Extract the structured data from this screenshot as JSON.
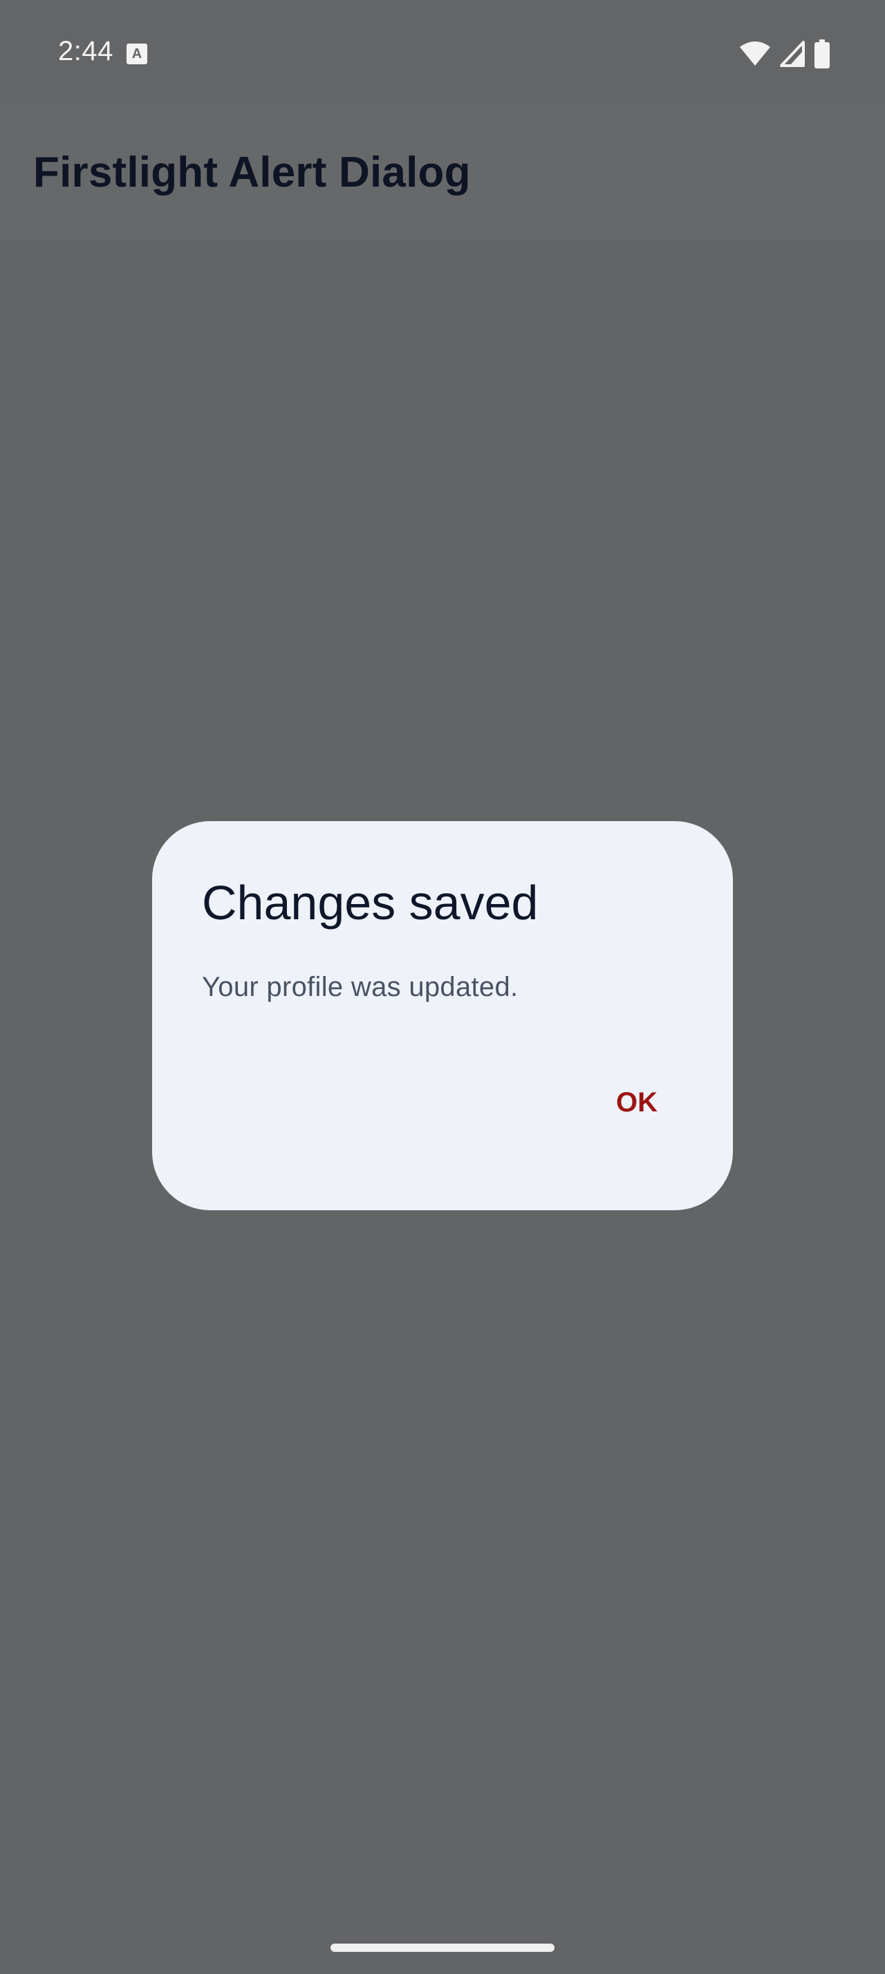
{
  "status_bar": {
    "time": "2:44",
    "notification_icon_letter": "A",
    "icons": [
      "wifi-icon",
      "cellular-signal-icon",
      "battery-icon"
    ]
  },
  "app_bar": {
    "title": "Firstlight Alert Dialog"
  },
  "dialog": {
    "title": "Changes saved",
    "message": "Your profile was updated.",
    "confirm_label": "OK"
  },
  "colors": {
    "scrim": "#646567",
    "dialog_surface": "#eff3f9",
    "title_text": "#10172b",
    "body_text": "#4a5263",
    "accent": "#9c1513",
    "app_title": "#0f1424"
  }
}
